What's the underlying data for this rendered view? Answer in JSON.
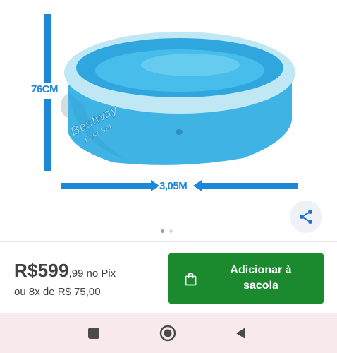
{
  "product_image": {
    "alt_description": "",
    "height_label": "76CM",
    "width_label": "3,05M",
    "brand_text": "Bestway",
    "brand_subtext": "Fast Set"
  },
  "carousel": {
    "total": 2,
    "active_index": 0
  },
  "price": {
    "main": "R$599",
    "cents": ",99",
    "method": "no Pix",
    "installments": "ou 8x de R$ 75,00"
  },
  "cta": {
    "line1": "Adicionar à",
    "line2": "sacola"
  },
  "icons": {
    "share": "share-icon",
    "bag": "shopping-bag-icon",
    "recents": "square-recents-icon",
    "home": "circle-home-icon",
    "back": "triangle-back-icon"
  },
  "colors": {
    "cta_green": "#1b8a2f",
    "dimension_blue": "#1e88d8",
    "share_blue": "#1f6fd6",
    "navbar_bg": "#f7e9ec"
  }
}
